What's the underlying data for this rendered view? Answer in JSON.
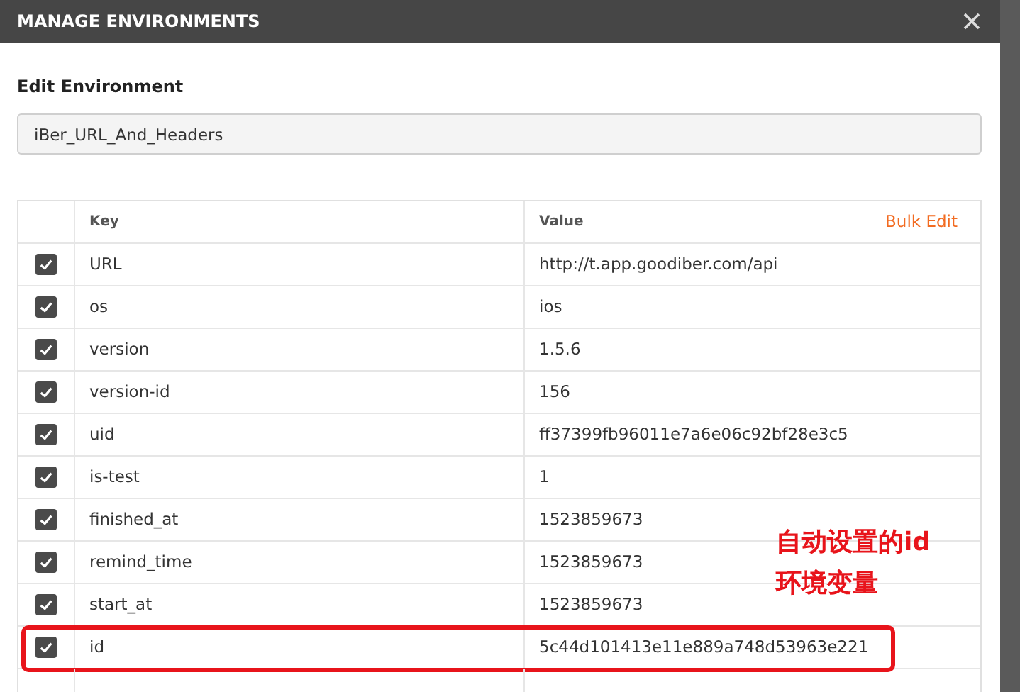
{
  "window": {
    "title": "MANAGE ENVIRONMENTS"
  },
  "section_label": "Edit Environment",
  "environment_name": {
    "value": "iBer_URL_And_Headers"
  },
  "table": {
    "columns": [
      "Key",
      "Value"
    ],
    "bulk_edit": "Bulk Edit",
    "rows": [
      {
        "checked": true,
        "key": "URL",
        "value": "http://t.app.goodiber.com/api"
      },
      {
        "checked": true,
        "key": "os",
        "value": "ios"
      },
      {
        "checked": true,
        "key": "version",
        "value": "1.5.6"
      },
      {
        "checked": true,
        "key": "version-id",
        "value": "156"
      },
      {
        "checked": true,
        "key": "uid",
        "value": "ff37399fb96011e7a6e06c92bf28e3c5"
      },
      {
        "checked": true,
        "key": "is-test",
        "value": "1"
      },
      {
        "checked": true,
        "key": "finished_at",
        "value": "1523859673"
      },
      {
        "checked": true,
        "key": "remind_time",
        "value": "1523859673"
      },
      {
        "checked": true,
        "key": "start_at",
        "value": "1523859673"
      },
      {
        "checked": true,
        "key": "id",
        "value": "5c44d101413e11e889a748d53963e221",
        "highlighted": true
      }
    ]
  },
  "annotation": {
    "lines": [
      "自动设置的id",
      "环境变量"
    ]
  }
}
